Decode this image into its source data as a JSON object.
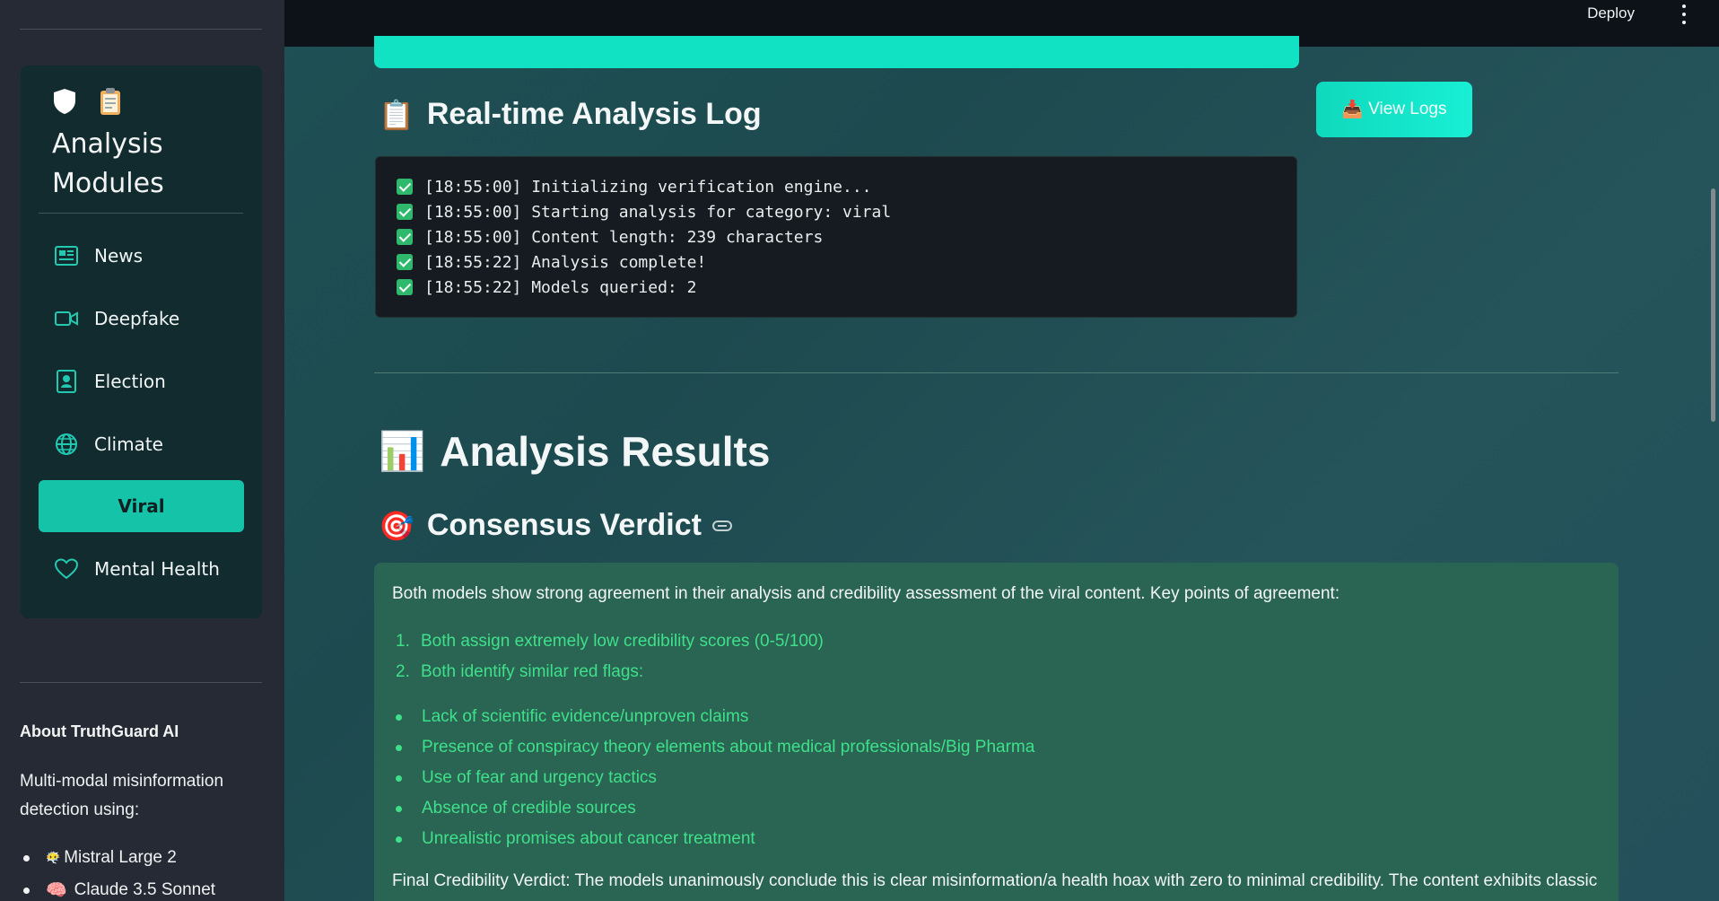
{
  "sidebar": {
    "modules_title": "Analysis Modules",
    "modules_icons": [
      "shield-icon",
      "clipboard-icon"
    ],
    "items": [
      {
        "label": "News",
        "icon": "newspaper-icon",
        "active": false
      },
      {
        "label": "Deepfake",
        "icon": "video-camera-icon",
        "active": false
      },
      {
        "label": "Election",
        "icon": "ballot-icon",
        "active": false
      },
      {
        "label": "Climate",
        "icon": "globe-icon",
        "active": false
      },
      {
        "label": "Viral",
        "icon": "",
        "active": true
      },
      {
        "label": "Mental Health",
        "icon": "heart-icon",
        "active": false
      }
    ],
    "about_title": "About TruthGuard AI",
    "about_text": "Multi-modal misinformation detection using:",
    "about_models": [
      {
        "emoji": "😶‍🌫️",
        "label": "Mistral Large 2"
      },
      {
        "emoji": "🧠",
        "label": "Claude 3.5 Sonnet"
      }
    ]
  },
  "topbar": {
    "deploy_label": "Deploy",
    "menu_icon": "kebab-menu-icon"
  },
  "log": {
    "heading": "Real-time Analysis Log",
    "heading_emoji": "📋",
    "view_logs_label": "View Logs",
    "view_logs_emoji": "📥",
    "lines": [
      "[18:55:00] Initializing verification engine...",
      "[18:55:00] Starting analysis for category: viral",
      "[18:55:00] Content length: 239 characters",
      "[18:55:22] Analysis complete!",
      "[18:55:22] Models queried: 2"
    ]
  },
  "results": {
    "heading": "Analysis Results",
    "heading_emoji": "📊",
    "verdict_heading": "Consensus Verdict",
    "verdict_emoji": "🎯",
    "intro": "Both models show strong agreement in their analysis and credibility assessment of the viral content. Key points of agreement:",
    "ordered": [
      "Both assign extremely low credibility scores (0-5/100)",
      "Both identify similar red flags:"
    ],
    "bullets": [
      "Lack of scientific evidence/unproven claims",
      "Presence of conspiracy theory elements about medical professionals/Big Pharma",
      "Use of fear and urgency tactics",
      "Absence of credible sources",
      "Unrealistic promises about cancer treatment"
    ],
    "final": "Final Credibility Verdict: The models unanimously conclude this is clear misinformation/a health hoax with zero to minimal credibility. The content exhibits classic"
  },
  "colors": {
    "accent": "#14c3a8",
    "list_green": "#3fe08a",
    "sidebar_bg": "#262a35",
    "verdict_bg": "#2a6453"
  }
}
